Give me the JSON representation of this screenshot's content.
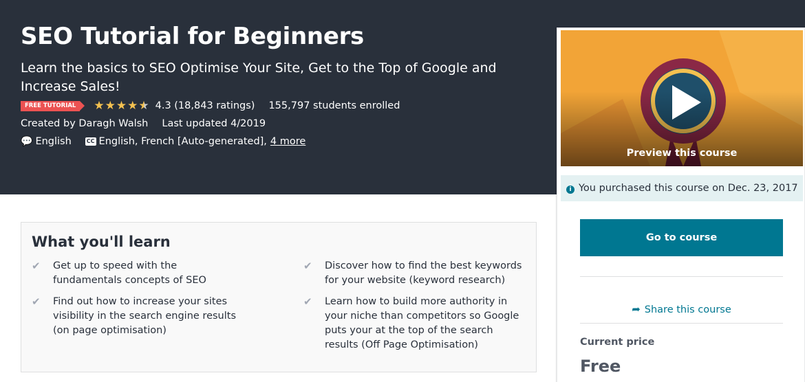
{
  "course": {
    "title": "SEO Tutorial for Beginners",
    "subtitle": "Learn the basics to SEO Optimise Your Site, Get to the Top of Google and Increase Sales!",
    "badge": "FREE TUTORIAL",
    "rating_value": 4.3,
    "rating_text": "4.3 (18,843 ratings)",
    "students": "155,797 students enrolled",
    "created_by": "Created by Daragh Walsh",
    "last_updated": "Last updated 4/2019",
    "language": "English",
    "captions": "English, French [Auto-generated],",
    "captions_more": "4 more",
    "cc_label": "CC"
  },
  "sidebar": {
    "preview_label": "Preview this course",
    "purchased_text": "You purchased this course on Dec. 23, 2017",
    "go_button": "Go to course",
    "share_label": "Share this course",
    "price_label": "Current price",
    "price": "Free"
  },
  "learn": {
    "title": "What you'll learn",
    "items": [
      "Get up to speed with the fundamentals concepts of SEO",
      "Discover how to find the best keywords for your website (keyword research)",
      "Find out how to increase your sites visibility in the search engine results (on page optimisation)",
      "Learn how to build more authority in your niche than competitors so Google puts your at the top of the search results (Off Page Optimisation)"
    ]
  },
  "icons": {
    "star": "star-icon",
    "speech_bubble": "speech-bubble-icon",
    "closed_captions": "closed-captions-icon",
    "play": "play-icon",
    "info": "info-icon",
    "share": "share-icon",
    "check": "check-icon"
  },
  "colors": {
    "hero_bg": "#29303b",
    "badge": "#ec5252",
    "star": "#f4c150",
    "primary": "#007791",
    "purchased_bg": "#e4f1f2"
  }
}
